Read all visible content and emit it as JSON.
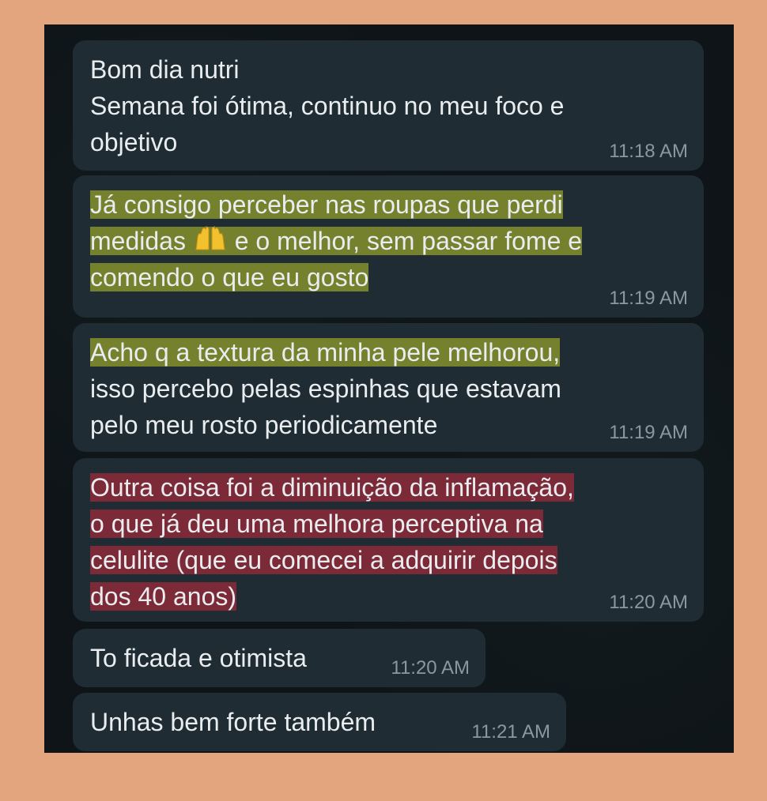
{
  "messages": [
    {
      "lines": [
        "Bom dia nutri",
        "Semana foi ótima, continuo no meu foco e",
        "objetivo"
      ],
      "time": "11:18 AM"
    },
    {
      "lines": [
        "Já consigo perceber nas roupas que perdi",
        "medidas",
        "e o melhor, sem passar fome e",
        "comendo o que eu gosto"
      ],
      "emoji": "raising-hands",
      "time": "11:19 AM"
    },
    {
      "lines": [
        "Acho q a textura da minha pele melhorou,",
        "isso percebo pelas espinhas que estavam",
        "pelo meu rosto periodicamente"
      ],
      "time": "11:19 AM"
    },
    {
      "lines": [
        "Outra coisa foi a diminuição da inflamação,",
        "o que já deu uma melhora perceptiva na",
        "celulite (que eu comecei a adquirir depois",
        "dos 40 anos)"
      ],
      "time": "11:20 AM"
    },
    {
      "lines": [
        "To ficada e otimista"
      ],
      "time": "11:20 AM"
    },
    {
      "lines": [
        "Unhas bem forte também"
      ],
      "time": "11:21 AM"
    }
  ],
  "colors": {
    "page_background": "#e3a57e",
    "chat_background": "#0e1417",
    "bubble": "#1f2c34",
    "text": "#e9edef",
    "timestamp": "#8c989f",
    "highlight_yellow": "#bec828",
    "highlight_red": "#c8283c"
  }
}
